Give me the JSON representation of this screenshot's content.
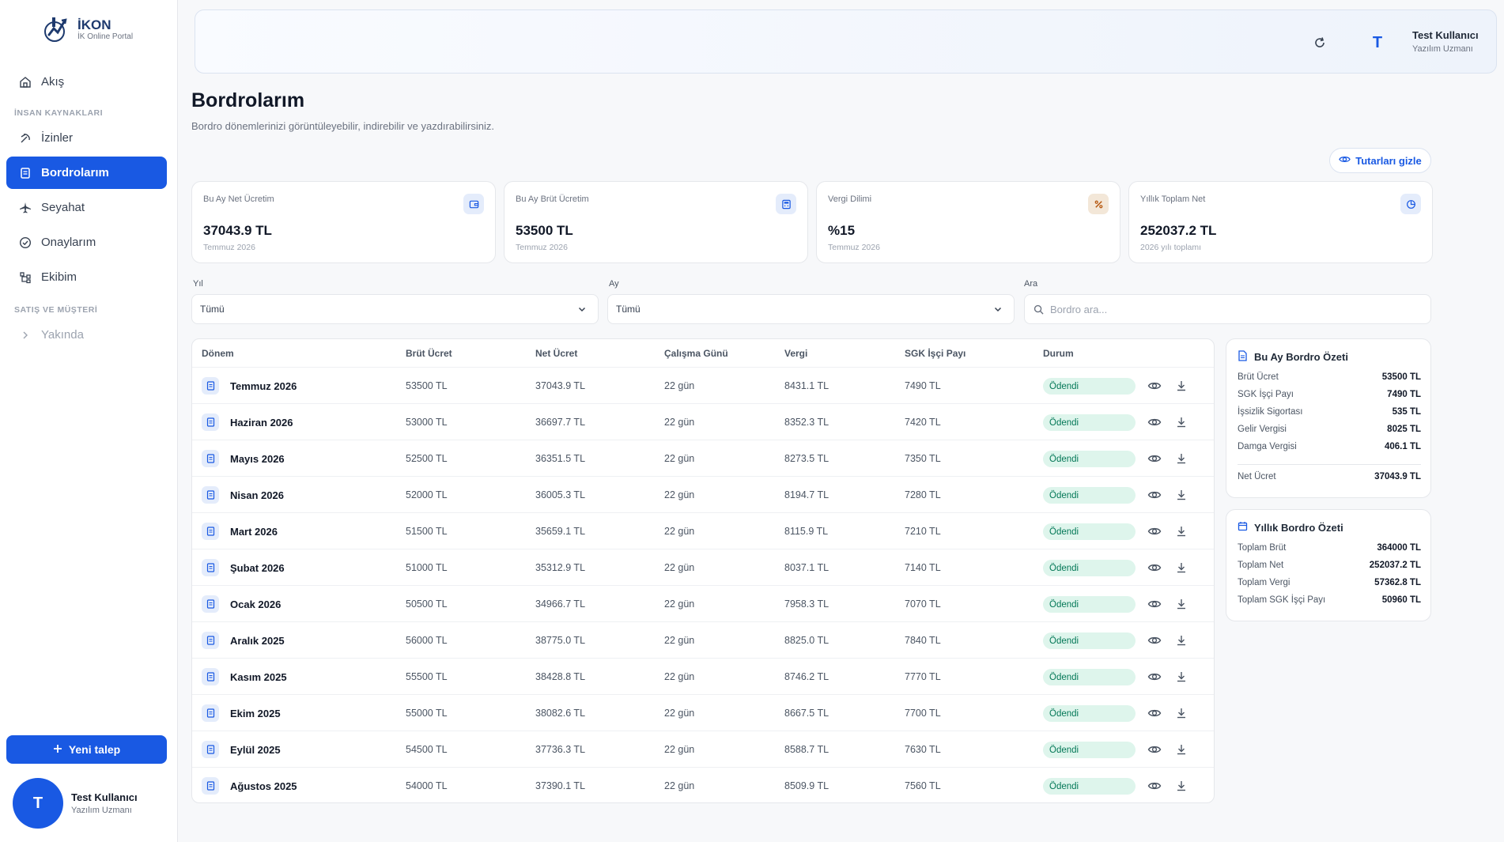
{
  "brand": {
    "name": "İKON",
    "tagline": "İK Online Portal"
  },
  "sidebar": {
    "items_top": [
      {
        "label": "Akış",
        "icon": "home-icon"
      }
    ],
    "section_hr": "İNSAN KAYNAKLARI",
    "items_hr": [
      {
        "label": "İzinler",
        "icon": "leave-icon"
      },
      {
        "label": "Bordrolarım",
        "icon": "receipt-icon",
        "active": true
      },
      {
        "label": "Seyahat",
        "icon": "plane-icon"
      },
      {
        "label": "Onaylarım",
        "icon": "check-circle-icon"
      },
      {
        "label": "Ekibim",
        "icon": "team-icon"
      }
    ],
    "section_sales": "SATIŞ VE MÜŞTERİ",
    "items_sales": [
      {
        "label": "Yakında",
        "icon": "chevron-right-icon",
        "disabled": true
      }
    ],
    "new_request": "Yeni talep",
    "user": {
      "initial": "T",
      "name": "Test Kullanıcı",
      "role": "Yazılım Uzmanı"
    }
  },
  "topbar": {
    "user": {
      "initial": "T",
      "name": "Test Kullanıcı",
      "role": "Yazılım Uzmanı"
    }
  },
  "page": {
    "title": "Bordrolarım",
    "subtitle": "Bordro dönemlerinizi görüntüleyebilir, indirebilir ve yazdırabilirsiniz.",
    "hide_amounts": "Tutarları gizle"
  },
  "cards": [
    {
      "label": "Bu Ay Net Ücretim",
      "value": "37043.9 TL",
      "sub": "Temmuz 2026",
      "icon": "wallet-icon"
    },
    {
      "label": "Bu Ay Brüt Ücretim",
      "value": "53500 TL",
      "sub": "Temmuz 2026",
      "icon": "calculator-icon"
    },
    {
      "label": "Vergi Dilimi",
      "value": "%15",
      "sub": "Temmuz 2026",
      "icon": "percent-icon"
    },
    {
      "label": "Yıllık Toplam Net",
      "value": "252037.2 TL",
      "sub": "2026 yılı toplamı",
      "icon": "pie-chart-icon"
    }
  ],
  "filters": {
    "year_label": "Yıl",
    "year_value": "Tümü",
    "month_label": "Ay",
    "month_value": "Tümü",
    "search_label": "Ara",
    "search_placeholder": "Bordro ara..."
  },
  "table": {
    "headers": [
      "Dönem",
      "Brüt Ücret",
      "Net Ücret",
      "Çalışma Günü",
      "Vergi",
      "SGK İşçi Payı",
      "Durum"
    ],
    "rows": [
      [
        "Temmuz 2026",
        "53500 TL",
        "37043.9 TL",
        "22 gün",
        "8431.1 TL",
        "7490 TL",
        "Ödendi"
      ],
      [
        "Haziran 2026",
        "53000 TL",
        "36697.7 TL",
        "22 gün",
        "8352.3 TL",
        "7420 TL",
        "Ödendi"
      ],
      [
        "Mayıs 2026",
        "52500 TL",
        "36351.5 TL",
        "22 gün",
        "8273.5 TL",
        "7350 TL",
        "Ödendi"
      ],
      [
        "Nisan 2026",
        "52000 TL",
        "36005.3 TL",
        "22 gün",
        "8194.7 TL",
        "7280 TL",
        "Ödendi"
      ],
      [
        "Mart 2026",
        "51500 TL",
        "35659.1 TL",
        "22 gün",
        "8115.9 TL",
        "7210 TL",
        "Ödendi"
      ],
      [
        "Şubat 2026",
        "51000 TL",
        "35312.9 TL",
        "22 gün",
        "8037.1 TL",
        "7140 TL",
        "Ödendi"
      ],
      [
        "Ocak 2026",
        "50500 TL",
        "34966.7 TL",
        "22 gün",
        "7958.3 TL",
        "7070 TL",
        "Ödendi"
      ],
      [
        "Aralık 2025",
        "56000 TL",
        "38775.0 TL",
        "22 gün",
        "8825.0 TL",
        "7840 TL",
        "Ödendi"
      ],
      [
        "Kasım 2025",
        "55500 TL",
        "38428.8 TL",
        "22 gün",
        "8746.2 TL",
        "7770 TL",
        "Ödendi"
      ],
      [
        "Ekim 2025",
        "55000 TL",
        "38082.6 TL",
        "22 gün",
        "8667.5 TL",
        "7700 TL",
        "Ödendi"
      ],
      [
        "Eylül 2025",
        "54500 TL",
        "37736.3 TL",
        "22 gün",
        "8588.7 TL",
        "7630 TL",
        "Ödendi"
      ],
      [
        "Ağustos 2025",
        "54000 TL",
        "37390.1 TL",
        "22 gün",
        "8509.9 TL",
        "7560 TL",
        "Ödendi"
      ]
    ]
  },
  "monthly_summary": {
    "title": "Bu Ay Bordro Özeti",
    "items": [
      {
        "k": "Brüt Ücret",
        "v": "53500 TL"
      },
      {
        "k": "SGK İşçi Payı",
        "v": "7490 TL"
      },
      {
        "k": "İşsizlik Sigortası",
        "v": "535 TL"
      },
      {
        "k": "Gelir Vergisi",
        "v": "8025 TL"
      },
      {
        "k": "Damga Vergisi",
        "v": "406.1 TL"
      }
    ],
    "net_label": "Net Ücret",
    "net_value": "37043.9 TL"
  },
  "yearly_summary": {
    "title": "Yıllık Bordro Özeti",
    "items": [
      {
        "k": "Toplam Brüt",
        "v": "364000 TL"
      },
      {
        "k": "Toplam Net",
        "v": "252037.2 TL"
      },
      {
        "k": "Toplam Vergi",
        "v": "57362.8 TL"
      },
      {
        "k": "Toplam SGK İşçi Payı",
        "v": "50960 TL"
      }
    ]
  },
  "colors": {
    "accent": "#1959e3",
    "badge_bg": "#def5ec",
    "badge_text": "#047857"
  }
}
